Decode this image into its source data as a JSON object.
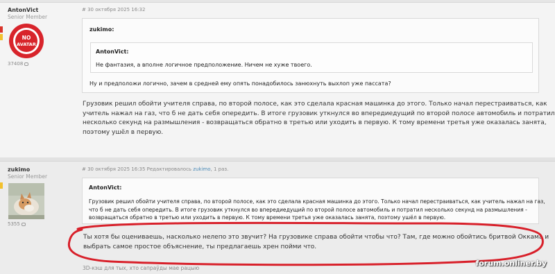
{
  "post1": {
    "author": "AntonVict",
    "rank": "Senior Member",
    "avatar_text": "NO AVATAR",
    "post_count": "37408",
    "meta": "# 30 октября 2025 16:32",
    "quote_author": "zukimo:",
    "nested_quote_author": "AntonVict:",
    "nested_quote_text": "Не фантазия, а вполне логичное предположение. Ничем не хуже твоего.",
    "quote_reply": "Ну и предположи логично, зачем в средней ему опять понадобилось занюхнуть выхлоп уже пассата?",
    "body_lines": [
      "Грузовик решил обойти учителя справа, по второй полосе, как это сделала красная машинка до этого. Только начал перестраиваться, как",
      "учитель нажал на газ, что б не дать себя опередить. В итоге грузовик уткнулся во впередиедущий по второй полосе автомобиль и потратил",
      "несколько секунд на размышления - возвращаться обратно в третью или уходить в первую. К тому времени третья уже оказалась занята,",
      "поэтому ушёл в первую."
    ]
  },
  "post2": {
    "author": "zukimo",
    "rank": "Senior Member",
    "post_count": "5355",
    "meta_prefix": "# 30 октября 2025 16:35 Редактировалось",
    "meta_editor": "zukimo",
    "meta_suffix": ", 1 раз.",
    "quote_author": "AntonVict:",
    "quote_lines": [
      "Грузовик решил обойти учителя справа, по второй полосе, как это сделала красная машинка до этого. Только начал перестраиваться, как учитель нажал на газ,",
      "что б не дать себя опередить. В итоге грузовик уткнулся во впередиедущий по второй полосе автомобиль и потратил несколько секунд на размышления -",
      "возвращаться обратно в третью или уходить в первую. К тому времени третья уже оказалась занята, поэтому ушёл в первую."
    ],
    "body_lines": [
      "Ты хотя бы оцениваешь, насколько нелепо это звучит? На грузовике справа обойти чтобы что? Там, где можно обойтись бритвой Оккама и",
      "выбрать самое простое объяснение, ты предлагаешь хрен пойми что."
    ],
    "signature": "3D-кэш для тых, хто сапраўды мае рацыю"
  },
  "watermark": "forum.onliner.by",
  "colors": {
    "highlight_circle": "#d8202a",
    "flag_red": "#d9342b",
    "flag_yellow": "#f2c12e",
    "avatar_red": "#d8242b",
    "link": "#4a8ab7"
  }
}
